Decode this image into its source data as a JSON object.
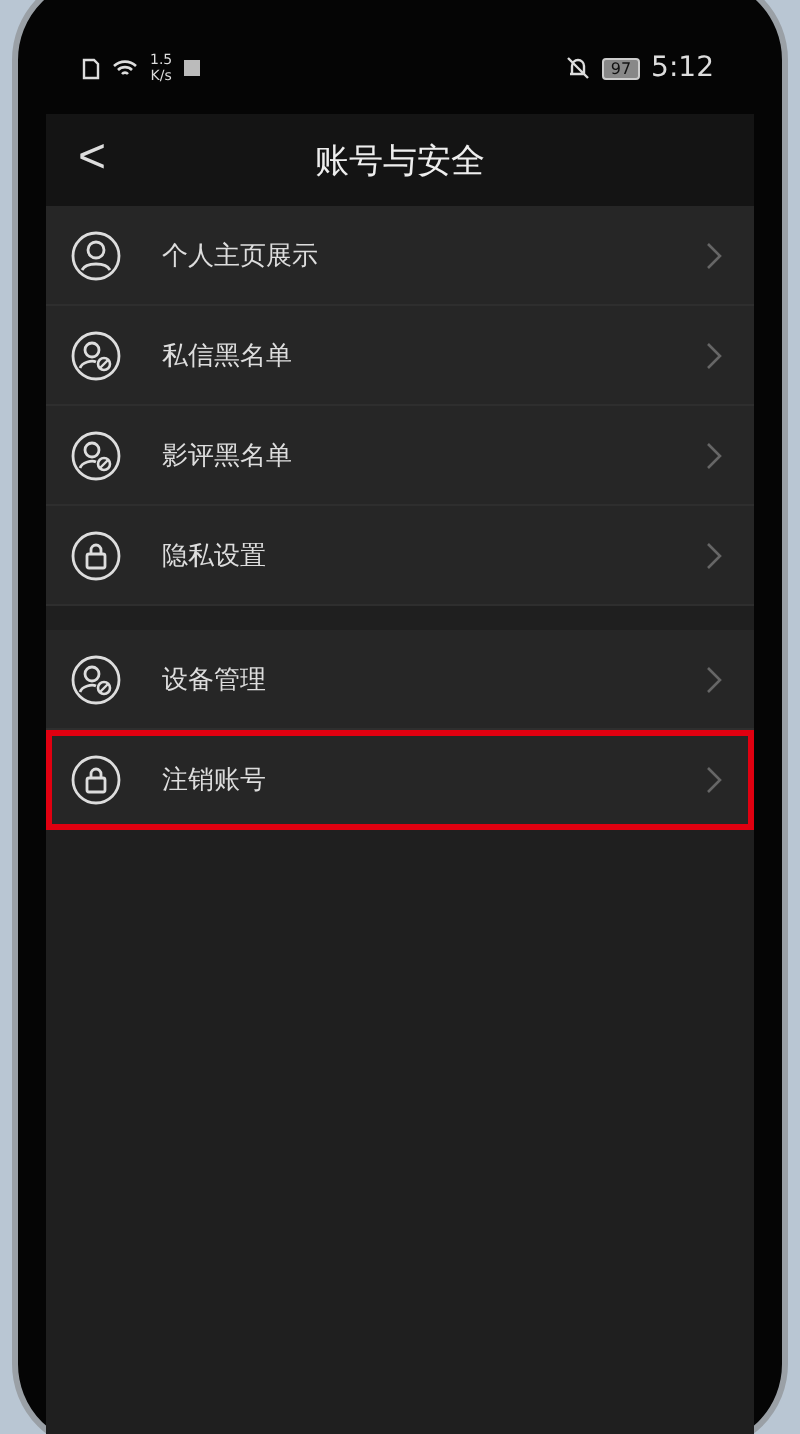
{
  "status_bar": {
    "speed": "1.5",
    "speed_unit": "K/s",
    "battery": "97",
    "time": "5:12"
  },
  "header": {
    "back": "<",
    "title": "账号与安全"
  },
  "groups": [
    {
      "items": [
        {
          "label": "个人主页展示",
          "kind": "person",
          "highlighted": false
        },
        {
          "label": "私信黑名单",
          "kind": "blocked",
          "highlighted": false
        },
        {
          "label": "影评黑名单",
          "kind": "blocked",
          "highlighted": false
        },
        {
          "label": "隐私设置",
          "kind": "lock",
          "highlighted": false
        }
      ]
    },
    {
      "items": [
        {
          "label": "设备管理",
          "kind": "blocked",
          "highlighted": false
        },
        {
          "label": "注销账号",
          "kind": "lock",
          "highlighted": true
        }
      ]
    }
  ]
}
